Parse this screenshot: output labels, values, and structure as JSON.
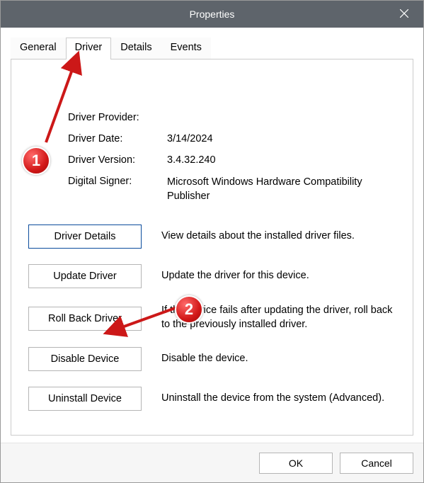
{
  "titlebar": {
    "title": "Properties"
  },
  "tabs": {
    "general": "General",
    "driver": "Driver",
    "details": "Details",
    "events": "Events"
  },
  "info": {
    "provider_label": "Driver Provider:",
    "provider_value": "",
    "date_label": "Driver Date:",
    "date_value": "3/14/2024",
    "version_label": "Driver Version:",
    "version_value": "3.4.32.240",
    "signer_label": "Digital Signer:",
    "signer_value": "Microsoft Windows Hardware Compatibility Publisher"
  },
  "actions": {
    "details_btn": "Driver Details",
    "details_desc": "View details about the installed driver files.",
    "update_btn": "Update Driver",
    "update_desc": "Update the driver for this device.",
    "rollback_btn": "Roll Back Driver",
    "rollback_desc": "If the device fails after updating the driver, roll back to the previously installed driver.",
    "disable_btn": "Disable Device",
    "disable_desc": "Disable the device.",
    "uninstall_btn": "Uninstall Device",
    "uninstall_desc": "Uninstall the device from the system (Advanced)."
  },
  "footer": {
    "ok": "OK",
    "cancel": "Cancel"
  },
  "annotations": {
    "badge1": "1",
    "badge2": "2"
  }
}
